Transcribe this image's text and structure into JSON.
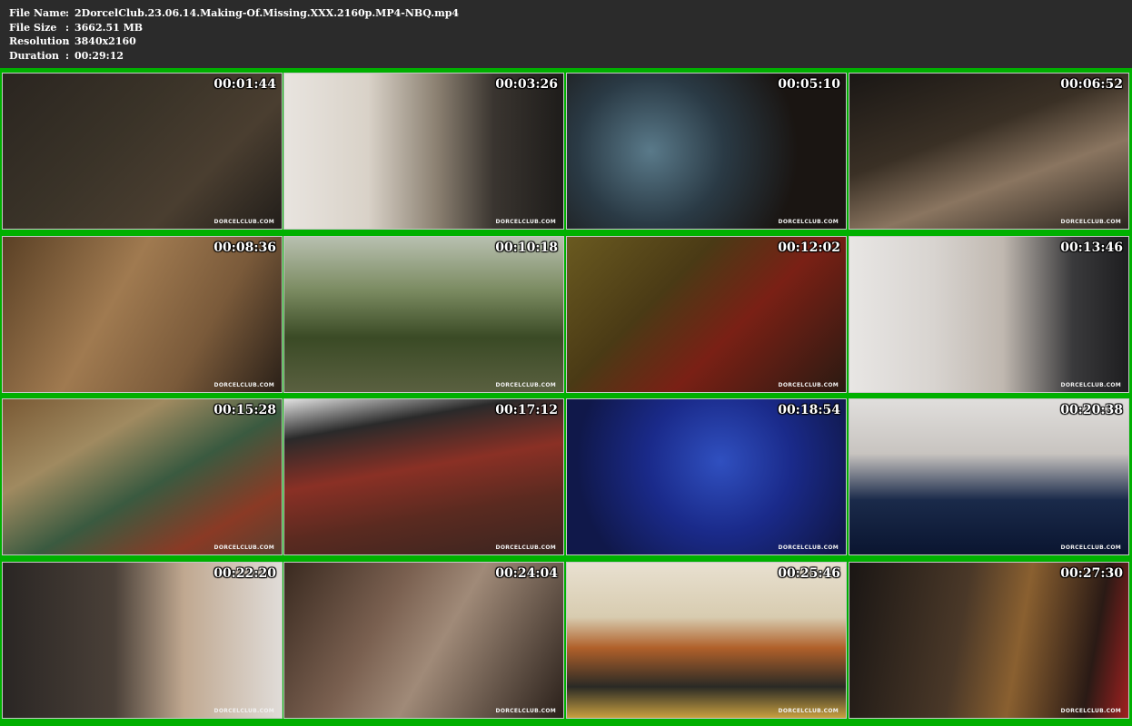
{
  "file_info": {
    "file_name_label": "File Name",
    "file_name_value": "2DorcelClub.23.06.14.Making-Of.Missing.XXX.2160p.MP4-NBQ.mp4",
    "file_size_label": "File Size",
    "file_size_value": "3662.51 MB",
    "resolution_label": "Resolution",
    "resolution_value": "3840x2160",
    "duration_label": "Duration",
    "duration_value": "00:29:12",
    "separator": ":"
  },
  "watermark": "DORCELCLUB.COM",
  "thumbnails": [
    {
      "timestamp": "00:01:44"
    },
    {
      "timestamp": "00:03:26"
    },
    {
      "timestamp": "00:05:10"
    },
    {
      "timestamp": "00:06:52"
    },
    {
      "timestamp": "00:08:36"
    },
    {
      "timestamp": "00:10:18"
    },
    {
      "timestamp": "00:12:02"
    },
    {
      "timestamp": "00:13:46"
    },
    {
      "timestamp": "00:15:28"
    },
    {
      "timestamp": "00:17:12"
    },
    {
      "timestamp": "00:18:54"
    },
    {
      "timestamp": "00:20:38"
    },
    {
      "timestamp": "00:22:20"
    },
    {
      "timestamp": "00:24:04"
    },
    {
      "timestamp": "00:25:46"
    },
    {
      "timestamp": "00:27:30"
    }
  ]
}
